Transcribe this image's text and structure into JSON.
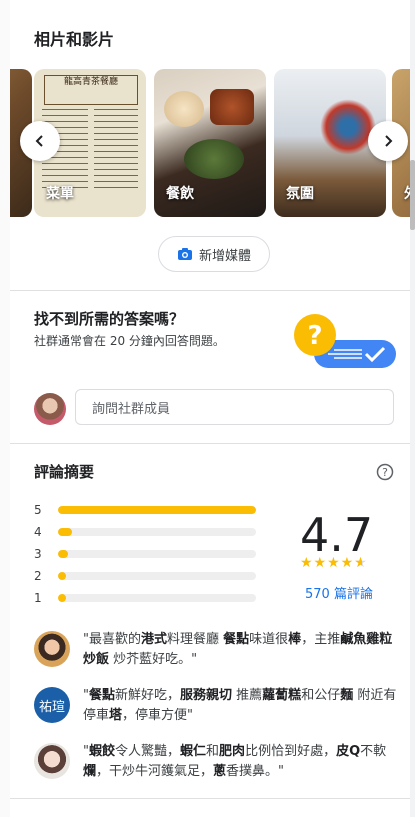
{
  "photos": {
    "title": "相片和影片",
    "items": [
      {
        "label": ""
      },
      {
        "label": "菜單",
        "menu_header": "龍高青茶餐廳"
      },
      {
        "label": "餐飲"
      },
      {
        "label": "氛圍"
      },
      {
        "label": "外"
      }
    ],
    "add_media_label": "新增媒體"
  },
  "qa": {
    "title": "找不到所需的答案嗎？",
    "subtitle": "社群通常會在 20 分鐘內回答問題。",
    "ask_placeholder": "詢問社群成員"
  },
  "reviews": {
    "title": "評論摘要",
    "rating": "4.7",
    "stars_value": 4.7,
    "count_label": "570 篇評論",
    "distribution": [
      {
        "star": "5",
        "fraction": 1.0
      },
      {
        "star": "4",
        "fraction": 0.07
      },
      {
        "star": "3",
        "fraction": 0.05
      },
      {
        "star": "2",
        "fraction": 0.04
      },
      {
        "star": "1",
        "fraction": 0.04
      }
    ],
    "snippets": [
      {
        "avatar_text": "",
        "parts": [
          [
            "\"最喜歡的",
            0
          ],
          [
            "港式",
            1
          ],
          [
            "料理餐廳 ",
            0
          ],
          [
            "餐點",
            1
          ],
          [
            "味道很",
            0
          ],
          [
            "棒",
            1
          ],
          [
            "，主推",
            0
          ],
          [
            "鹹魚",
            1
          ],
          [
            "雞粒炒飯",
            1
          ],
          [
            " 炒芥藍好吃。\"",
            0
          ]
        ]
      },
      {
        "avatar_text": "祐瑄",
        "parts": [
          [
            "\"",
            0
          ],
          [
            "餐點",
            1
          ],
          [
            "新鮮好吃，",
            0
          ],
          [
            "服務親切",
            1
          ],
          [
            " 推薦",
            0
          ],
          [
            "蘿蔔糕",
            1
          ],
          [
            "和公仔",
            0
          ],
          [
            "麵",
            1
          ],
          [
            " 附近有停車",
            0
          ],
          [
            "塔",
            1
          ],
          [
            "，停車方便\"",
            0
          ]
        ]
      },
      {
        "avatar_text": "",
        "parts": [
          [
            "\"",
            0
          ],
          [
            "蝦餃",
            1
          ],
          [
            "令人驚豔，",
            0
          ],
          [
            "蝦仁",
            1
          ],
          [
            "和",
            0
          ],
          [
            "肥肉",
            1
          ],
          [
            "比例恰到好處，",
            0
          ],
          [
            "皮Q",
            1
          ],
          [
            "不軟",
            0
          ],
          [
            "爛",
            1
          ],
          [
            "，干炒牛河鑊氣足，",
            0
          ],
          [
            "蔥",
            1
          ],
          [
            "香撲鼻。\"",
            0
          ]
        ]
      }
    ]
  },
  "colors": {
    "star": "#fbbc04",
    "link": "#1a73e8",
    "avatar_blue": "#1a5fa8"
  }
}
